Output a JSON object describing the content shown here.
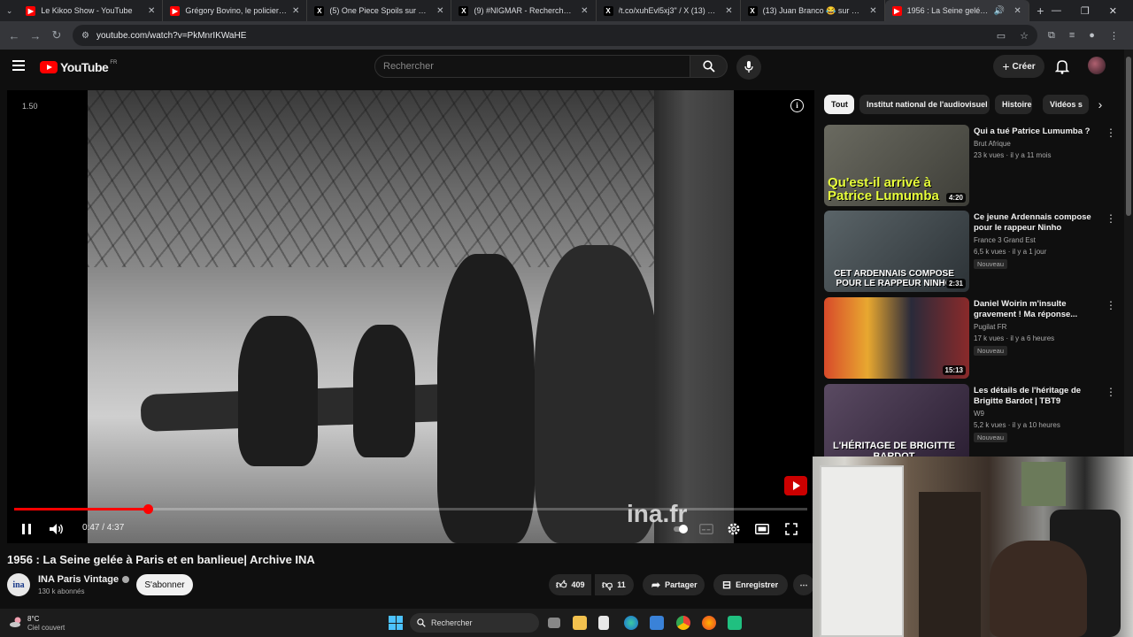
{
  "browser": {
    "tabs": [
      {
        "title": "Le Kikoo Show - YouTube",
        "favicon": "youtube-icon",
        "color": "#ff0000",
        "active": false
      },
      {
        "title": "Grégory Bovino, le policier qui",
        "favicon": "youtube-icon",
        "color": "#ff0000",
        "active": false
      },
      {
        "title": "(5) One Piece Spoils sur X : \"#O",
        "favicon": "x-icon",
        "color": "#000000",
        "active": false
      },
      {
        "title": "(9) #NIGMAR - Recherche / X",
        "favicon": "x-icon",
        "color": "#000000",
        "active": false
      },
      {
        "title": "/t.co/xuhEvl5xj3\" / X فتحي (13)",
        "favicon": "x-icon",
        "color": "#000000",
        "active": false
      },
      {
        "title": "(13) Juan Branco 😂 sur X : \"@",
        "favicon": "x-icon",
        "color": "#000000",
        "active": false
      },
      {
        "title": "1956 : La Seine gelée à Paris",
        "favicon": "youtube-icon",
        "color": "#ff0000",
        "active": true
      }
    ],
    "new_tab": "+",
    "window_controls": [
      "—",
      "❐",
      "✕"
    ],
    "url": "youtube.com/watch?v=PkMnrIKWaHE"
  },
  "youtube": {
    "logo_text": "YouTube",
    "logo_country": "FR",
    "search_placeholder": "Rechercher",
    "create_label": "Créer"
  },
  "player": {
    "label": "1.50",
    "time_current": "0:47",
    "time_total": "4:37",
    "time_text": "0:47 / 4:37",
    "progress": 0.168,
    "watermark": "ina.fr",
    "accent_color": "#ff0000"
  },
  "video": {
    "title": "1956 : La Seine gelée à Paris et en banlieue| Archive INA",
    "channel_name": "INA Paris Vintage",
    "channel_avatar_text": "ina",
    "subscribers": "130 k abonnés",
    "subscribe_label": "S'abonner",
    "likes": "409",
    "dislikes": "11",
    "share_label": "Partager",
    "save_label": "Enregistrer"
  },
  "chips": [
    "Tout",
    "Institut national de l'audiovisuel",
    "Histoire",
    "Vidéos s"
  ],
  "recommendations": [
    {
      "title": "Qui a tué Patrice Lumumba ?",
      "channel": "Brut Afrique",
      "meta": "23 k vues · il y a 11 mois",
      "duration": "4:20",
      "thumb_text": "Qu'est-il arrivé à Patrice Lumumba",
      "badge": "",
      "thumb_bg": "#5a5a52",
      "thumb_color": "#e8ff3a"
    },
    {
      "title": "Ce jeune Ardennais compose pour le rappeur Ninho",
      "channel": "France 3 Grand Est",
      "meta": "6,5 k vues · il y a 1 jour",
      "duration": "2:31",
      "thumb_text": "CET ARDENNAIS COMPOSE POUR LE RAPPEUR NINHO",
      "badge": "Nouveau",
      "thumb_bg": "#3c4448",
      "thumb_color": "#ffffff"
    },
    {
      "title": "Daniel Woirin m'insulte gravement ! Ma réponse...",
      "channel": "Pugilat FR",
      "meta": "17 k vues · il y a 6 heures",
      "duration": "15:13",
      "thumb_text": "",
      "badge": "Nouveau",
      "thumb_bg": "#c0402a",
      "thumb_color": "#ffffff"
    },
    {
      "title": "Les détails de l'héritage de Brigitte Bardot | TBT9",
      "channel": "W9",
      "meta": "5,2 k vues · il y a 10 heures",
      "duration": "",
      "thumb_text": "L'HÉRITAGE DE BRIGITTE BARDOT",
      "badge": "Nouveau",
      "thumb_bg": "#4a3a52",
      "thumb_color": "#ffffff"
    }
  ],
  "taskbar": {
    "weather_temp": "8°C",
    "weather_desc": "Ciel couvert",
    "search_placeholder": "Rechercher"
  }
}
